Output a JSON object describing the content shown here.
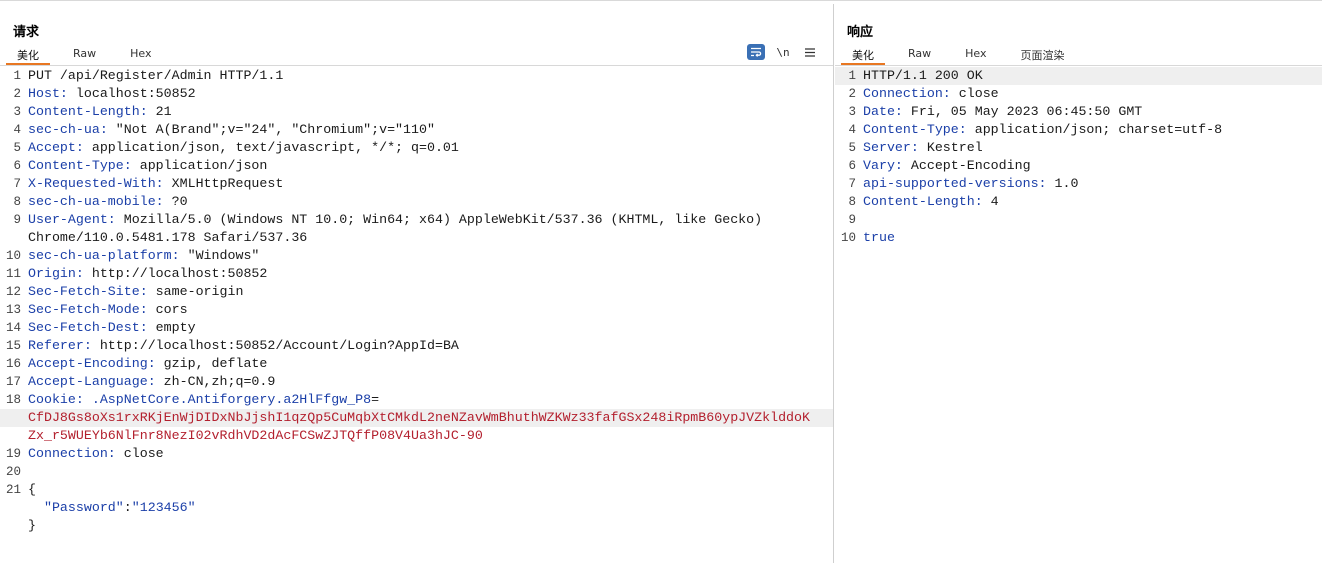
{
  "request": {
    "title": "请求",
    "tabs": [
      "美化",
      "Raw",
      "Hex"
    ],
    "active_tab": "美化",
    "tools": {
      "wrap_icon": "wrap-lines-icon",
      "newline_label": "\\n",
      "menu_icon": "menu-icon"
    },
    "lines": [
      {
        "n": "1",
        "t": "PUT /api/Register/Admin HTTP/1.1"
      },
      {
        "n": "2",
        "k": "Host:",
        "v": " localhost:50852"
      },
      {
        "n": "3",
        "k": "Content-Length:",
        "v": " 21"
      },
      {
        "n": "4",
        "k": "sec-ch-ua:",
        "v": " \"Not A(Brand\";v=\"24\", \"Chromium\";v=\"110\""
      },
      {
        "n": "5",
        "k": "Accept:",
        "v": " application/json, text/javascript, */*; q=0.01"
      },
      {
        "n": "6",
        "k": "Content-Type:",
        "v": " application/json"
      },
      {
        "n": "7",
        "k": "X-Requested-With:",
        "v": " XMLHttpRequest"
      },
      {
        "n": "8",
        "k": "sec-ch-ua-mobile:",
        "v": " ?0"
      },
      {
        "n": "9",
        "k": "User-Agent:",
        "v": " Mozilla/5.0 (Windows NT 10.0; Win64; x64) AppleWebKit/537.36 (KHTML, like Gecko)"
      },
      {
        "n": "",
        "v": "Chrome/110.0.5481.178 Safari/537.36"
      },
      {
        "n": "10",
        "k": "sec-ch-ua-platform:",
        "v": " \"Windows\""
      },
      {
        "n": "11",
        "k": "Origin:",
        "v": " http://localhost:50852"
      },
      {
        "n": "12",
        "k": "Sec-Fetch-Site:",
        "v": " same-origin"
      },
      {
        "n": "13",
        "k": "Sec-Fetch-Mode:",
        "v": " cors"
      },
      {
        "n": "14",
        "k": "Sec-Fetch-Dest:",
        "v": " empty"
      },
      {
        "n": "15",
        "k": "Referer:",
        "v": " http://localhost:50852/Account/Login?AppId=BA"
      },
      {
        "n": "16",
        "k": "Accept-Encoding:",
        "v": " gzip, deflate"
      },
      {
        "n": "17",
        "k": "Accept-Language:",
        "v": " zh-CN,zh;q=0.9"
      },
      {
        "n": "18",
        "k": "Cookie:",
        "ck": " .AspNetCore.Antiforgery.a2HlFfgw_P8",
        "v": "="
      },
      {
        "n": "",
        "r": "CfDJ8Gs8oXs1rxRKjEnWjDIDxNbJjshI1qzQp5CuMqbXtCMkdL2neNZavWmBhuthWZKWz33fafGSx248iRpmB60ypJVZklddoK",
        "hl": true
      },
      {
        "n": "",
        "r": "Zx_r5WUEYb6NlFnr8NezI02vRdhVD2dAcFCSwZJTQffP08V4Ua3hJC-90"
      },
      {
        "n": "19",
        "k": "Connection:",
        "v": " close"
      },
      {
        "n": "20",
        "t": ""
      },
      {
        "n": "21",
        "t": "{"
      },
      {
        "n": "",
        "jk": "  \"Password\"",
        "jc": ":",
        "jv": "\"123456\""
      },
      {
        "n": "",
        "t": "}"
      }
    ]
  },
  "response": {
    "title": "响应",
    "tabs": [
      "美化",
      "Raw",
      "Hex",
      "页面渲染"
    ],
    "active_tab": "美化",
    "lines": [
      {
        "n": "1",
        "t": "HTTP/1.1 200 OK",
        "hl": true
      },
      {
        "n": "2",
        "k": "Connection:",
        "v": " close"
      },
      {
        "n": "3",
        "k": "Date:",
        "v": " Fri, 05 May 2023 06:45:50 GMT"
      },
      {
        "n": "4",
        "k": "Content-Type:",
        "v": " application/json; charset=utf-8"
      },
      {
        "n": "5",
        "k": "Server:",
        "v": " Kestrel"
      },
      {
        "n": "6",
        "k": "Vary:",
        "v": " Accept-Encoding"
      },
      {
        "n": "7",
        "k": "api-supported-versions:",
        "v": " 1.0"
      },
      {
        "n": "8",
        "k": "Content-Length:",
        "v": " 4"
      },
      {
        "n": "9",
        "t": ""
      },
      {
        "n": "10",
        "k": "true"
      }
    ]
  },
  "colors": {
    "accent": "#e87722",
    "header_key": "#1b3fa8",
    "cookie_value": "#b3202e",
    "wrap_button": "#3a70b5"
  }
}
